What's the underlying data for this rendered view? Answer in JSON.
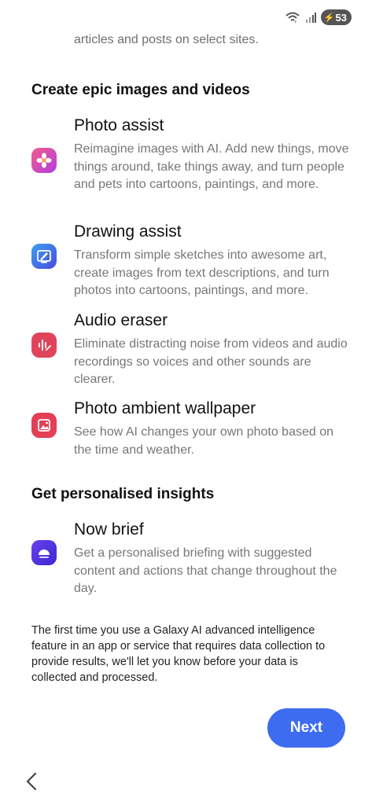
{
  "status_bar": {
    "battery_level": "53"
  },
  "intro": {
    "text": "articles and posts on select sites."
  },
  "sections": [
    {
      "title": "Create epic images and videos",
      "features": [
        {
          "title": "Photo assist",
          "description": "Reimagine images with AI. Add new things, move things around, take things away, and turn people and pets into cartoons, paintings, and more.",
          "icon": "photo-assist-icon"
        },
        {
          "title": "Drawing assist",
          "description": "Transform simple sketches into awesome art, create images from text descriptions, and turn photos into cartoons, paintings, and more.",
          "icon": "drawing-assist-icon"
        },
        {
          "title": "Audio eraser",
          "description": "Eliminate distracting noise from videos and audio recordings so voices and other sounds are clearer.",
          "icon": "audio-eraser-icon"
        },
        {
          "title": "Photo ambient wallpaper",
          "description": "See how AI changes your own photo based on the time and weather.",
          "icon": "photo-ambient-wallpaper-icon"
        }
      ]
    },
    {
      "title": "Get personalised insights",
      "features": [
        {
          "title": "Now brief",
          "description": "Get a personalised briefing with suggested content and actions that change throughout the day.",
          "icon": "now-brief-icon"
        }
      ]
    }
  ],
  "footer": {
    "note": "The first time you use a Galaxy AI advanced intelligence feature in an app or service that requires data collection to provide results, we'll let you know before your data is collected and processed."
  },
  "actions": {
    "next_label": "Next"
  },
  "colors": {
    "accent": "#3e6cf0",
    "audio_eraser": "#e0445a",
    "wallpaper": "#e33f55",
    "now_brief": "#5b3ee6"
  }
}
